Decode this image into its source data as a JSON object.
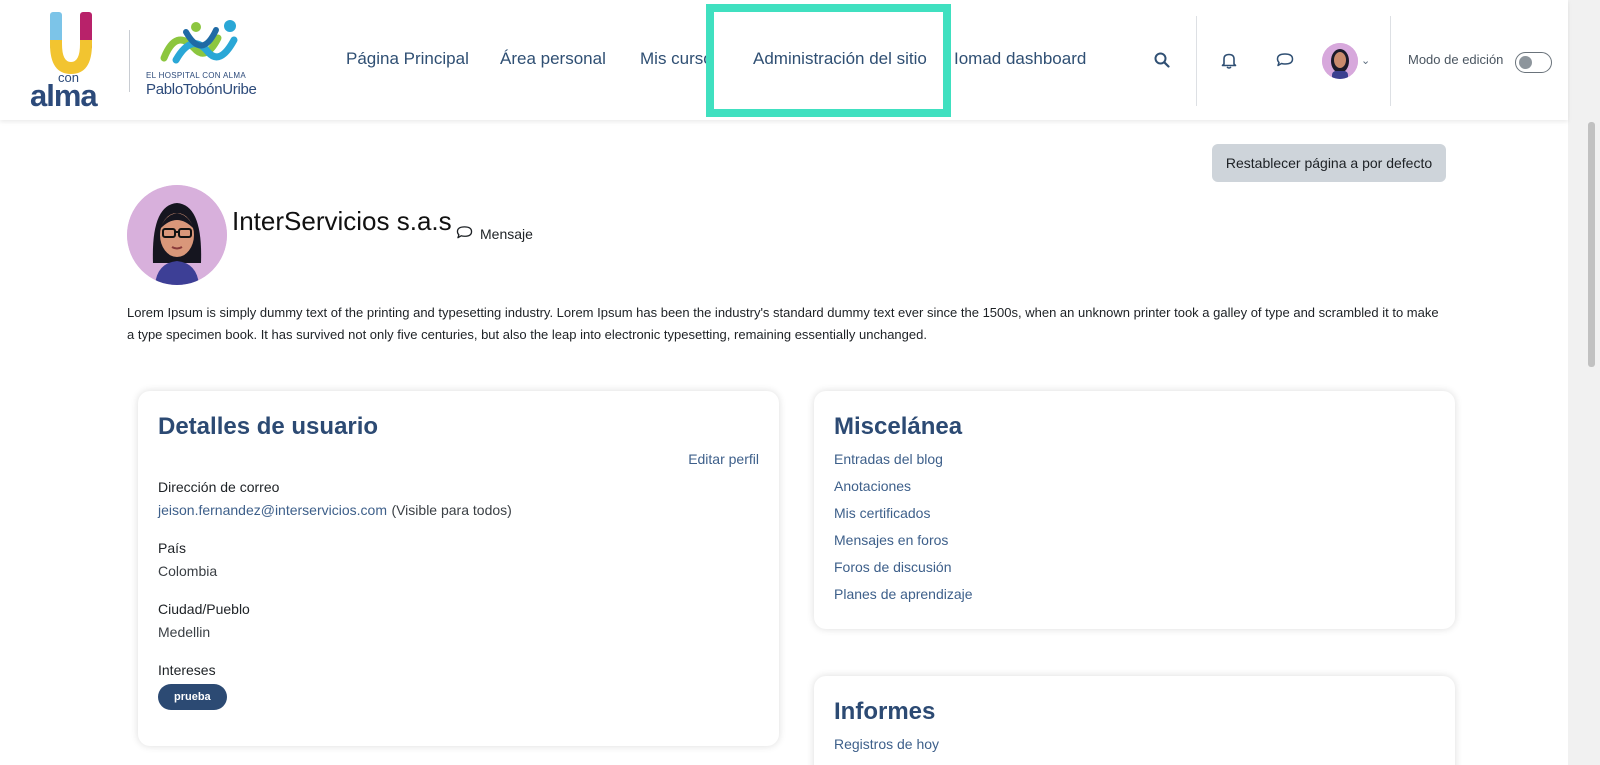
{
  "logo": {
    "app_text": "con",
    "app_text2": "alma",
    "hospital_tagline": "EL HOSPITAL CON ALMA",
    "hospital_name": "PabloTobónUribe"
  },
  "nav": {
    "items": [
      {
        "label": "Página Principal"
      },
      {
        "label": "Área personal"
      },
      {
        "label": "Mis cursos"
      },
      {
        "label": "Administración del sitio"
      },
      {
        "label": "Iomad dashboard"
      }
    ]
  },
  "header": {
    "edit_mode_label": "Modo de edición",
    "icons": [
      "search-icon",
      "bell-icon",
      "chat-icon",
      "chevron-down-icon"
    ]
  },
  "actions": {
    "reset_label": "Restablecer página a por defecto"
  },
  "profile": {
    "name": "InterServicios s.a.s",
    "message_label": "Mensaje",
    "description": "Lorem Ipsum is simply dummy text of the printing and typesetting industry. Lorem Ipsum has been the industry's standard dummy text ever since the 1500s, when an unknown printer took a galley of type and scrambled it to make a type specimen book. It has survived not only five centuries, but also the leap into electronic typesetting, remaining essentially unchanged."
  },
  "user_details": {
    "title": "Detalles de usuario",
    "edit_label": "Editar perfil",
    "email_label": "Dirección de correo",
    "email_value": "jeison.fernandez@interservicios.com",
    "email_visibility": "(Visible para todos)",
    "country_label": "País",
    "country_value": "Colombia",
    "city_label": "Ciudad/Pueblo",
    "city_value": "Medellin",
    "interests_label": "Intereses",
    "interest_tag": "prueba"
  },
  "misc": {
    "title": "Miscelánea",
    "links": [
      "Entradas del blog",
      "Anotaciones",
      "Mis certificados",
      "Mensajes en foros",
      "Foros de discusión",
      "Planes de aprendizaje"
    ]
  },
  "reports": {
    "title": "Informes",
    "links": [
      "Registros de hoy"
    ]
  },
  "colors": {
    "accent": "#2c4a73",
    "highlight": "#40e0c0",
    "avatar_bg": "#d8b0dc"
  }
}
